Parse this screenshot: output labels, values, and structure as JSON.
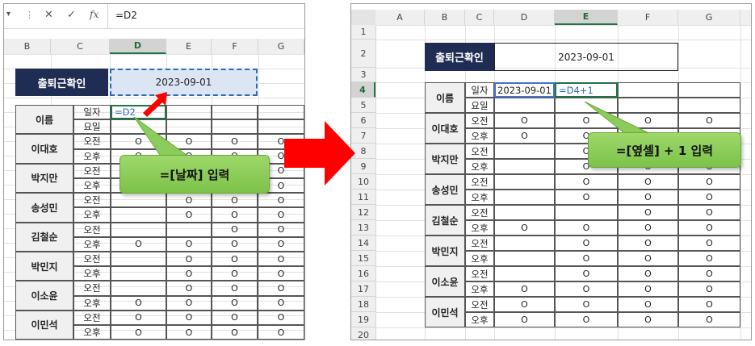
{
  "left": {
    "formula_bar": {
      "name_box_arrow": "▾",
      "dots": "⋮",
      "cancel": "✕",
      "enter": "✓",
      "fx": "fx",
      "formula": "=D2"
    },
    "columns": [
      "B",
      "C",
      "D",
      "E",
      "F",
      "G"
    ],
    "title_label": "출퇴근확인",
    "date_value": "2023-09-01",
    "row_labels": {
      "date": "일자",
      "day": "요일"
    },
    "editing_formula": "=D2",
    "callout": "=[날짜] 입력"
  },
  "right": {
    "columns": [
      "A",
      "B",
      "C",
      "D",
      "E",
      "F",
      "G"
    ],
    "rows": [
      "1",
      "2",
      "3",
      "4",
      "5",
      "6",
      "7",
      "8",
      "9",
      "10",
      "11",
      "12",
      "13",
      "14",
      "15",
      "16",
      "17",
      "18",
      "19",
      "20"
    ],
    "title_label": "출퇴근확인",
    "date_value": "2023-09-01",
    "row_labels": {
      "date": "일자",
      "day": "요일"
    },
    "d4_value": "2023-09-01",
    "e4_formula": "=D4+1",
    "callout": "=[옆셀] + 1 입력"
  },
  "people": [
    "이대호",
    "박지만",
    "송성민",
    "김철순",
    "박민지",
    "이소윤",
    "이민석"
  ],
  "shifts": [
    "오전",
    "오후"
  ],
  "mark": "O",
  "marks_left": [
    [
      1,
      1,
      1,
      1
    ],
    [
      1,
      1,
      1,
      1
    ],
    [
      0,
      1,
      1,
      1
    ],
    [
      0,
      1,
      1,
      1
    ],
    [
      0,
      1,
      1,
      1
    ],
    [
      0,
      1,
      1,
      1
    ],
    [
      0,
      0,
      1,
      1
    ],
    [
      1,
      1,
      1,
      1
    ],
    [
      0,
      1,
      1,
      1
    ],
    [
      0,
      1,
      1,
      1
    ],
    [
      0,
      1,
      1,
      1
    ],
    [
      1,
      1,
      1,
      1
    ],
    [
      1,
      1,
      1,
      1
    ],
    [
      1,
      1,
      1,
      1
    ]
  ],
  "marks_right": [
    [
      1,
      1,
      1,
      1
    ],
    [
      1,
      1,
      1,
      1
    ],
    [
      0,
      1,
      1,
      1
    ],
    [
      0,
      1,
      1,
      1
    ],
    [
      0,
      1,
      1,
      1
    ],
    [
      0,
      1,
      1,
      1
    ],
    [
      0,
      0,
      1,
      1
    ],
    [
      1,
      1,
      1,
      1
    ],
    [
      0,
      1,
      1,
      1
    ],
    [
      0,
      1,
      1,
      1
    ],
    [
      0,
      1,
      1,
      1
    ],
    [
      1,
      1,
      1,
      1
    ],
    [
      1,
      1,
      1,
      1
    ],
    [
      1,
      1,
      1,
      1
    ]
  ],
  "colors": {
    "navy": "#1f2d54",
    "callout_green": "#8ccc5a",
    "arrow_red": "#ff0000",
    "selection_green": "#217346",
    "ref_blue": "#4472c4"
  }
}
